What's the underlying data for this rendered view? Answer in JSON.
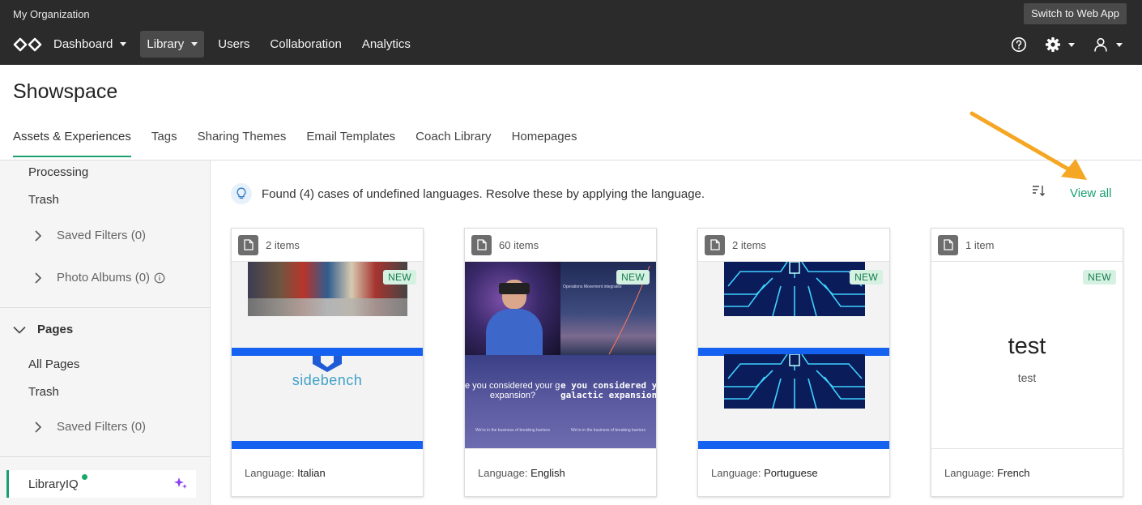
{
  "topbar": {
    "org_name": "My Organization",
    "switch_label": "Switch to Web App",
    "nav": [
      {
        "label": "Dashboard",
        "has_caret": true,
        "active": false
      },
      {
        "label": "Library",
        "has_caret": true,
        "active": true
      },
      {
        "label": "Users",
        "has_caret": false,
        "active": false
      },
      {
        "label": "Collaboration",
        "has_caret": false,
        "active": false
      },
      {
        "label": "Analytics",
        "has_caret": false,
        "active": false
      }
    ],
    "icons": [
      "help-icon",
      "settings-icon",
      "user-icon"
    ]
  },
  "page": {
    "title": "Showspace",
    "tabs": [
      "Assets & Experiences",
      "Tags",
      "Sharing Themes",
      "Email Templates",
      "Coach Library",
      "Homepages"
    ],
    "active_tab": "Assets & Experiences"
  },
  "sidebar": {
    "processing": "Processing",
    "trash_1": "Trash",
    "saved_filters_1": "Saved Filters (0)",
    "photo_albums": "Photo Albums (0)",
    "pages_section": "Pages",
    "all_pages": "All Pages",
    "trash_2": "Trash",
    "saved_filters_2": "Saved Filters (0)",
    "library_iq": "LibraryIQ"
  },
  "notice": {
    "text": "Found (4) cases of undefined languages. Resolve these by applying the language.",
    "view_all": "View all"
  },
  "cards": [
    {
      "count": "2 items",
      "badge": "NEW",
      "language_label": "Language:",
      "language": "Italian",
      "thumb_text": "sidebench"
    },
    {
      "count": "60 items",
      "badge": "NEW",
      "language_label": "Language:",
      "language": "English",
      "thumb_lines": {
        "small_header": "Operations Movement integrates",
        "q1": "e you considered your gr",
        "q2": "expansion?",
        "q3": "e you considered y",
        "q4": "galactic expansion",
        "foot": "We're in the business of breaking barriers"
      }
    },
    {
      "count": "2 items",
      "badge": "NEW",
      "language_label": "Language:",
      "language": "Portuguese"
    },
    {
      "count": "1 item",
      "badge": "NEW",
      "language_label": "Language:",
      "language": "French",
      "thumb_title": "test",
      "thumb_subtitle": "test"
    }
  ],
  "colors": {
    "accent": "#1a9f6f",
    "topbar": "#2b2b2b",
    "annotation_arrow": "#f5a623",
    "bluebar": "#1662f0"
  }
}
